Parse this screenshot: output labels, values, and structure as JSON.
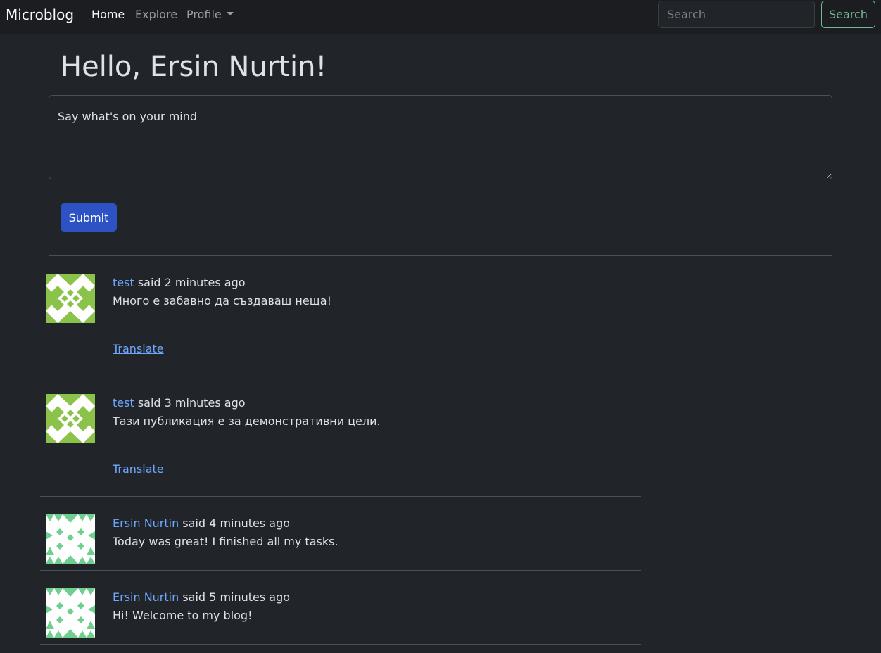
{
  "navbar": {
    "brand": "Microblog",
    "links": [
      {
        "label": "Home"
      },
      {
        "label": "Explore"
      },
      {
        "label": "Profile"
      }
    ],
    "search_placeholder": "Search",
    "search_button": "Search"
  },
  "main": {
    "title": "Hello, Ersin Nurtin!",
    "textarea_placeholder": "Say what's on your mind",
    "submit_label": "Submit"
  },
  "posts": [
    {
      "author": "test",
      "said": "said 2 minutes ago",
      "body": "Много е забавно да създаваш неща!",
      "translate": "Translate"
    },
    {
      "author": "test",
      "said": "said 3 minutes ago",
      "body": "Тази публикация е за демонстративни цели.",
      "translate": "Translate"
    },
    {
      "author": "Ersin Nurtin",
      "said": "said 4 minutes ago",
      "body": "Today was great! I finished all my tasks."
    },
    {
      "author": "Ersin Nurtin",
      "said": "said 5 minutes ago",
      "body": "Hi! Welcome to my blog!"
    }
  ],
  "colors": {
    "background": "#212529",
    "navbar": "#1b1d20",
    "link": "#6ea8fe",
    "submit": "#2d52c4",
    "search_outline": "#75b798",
    "avatar_test": "#8bc34a",
    "avatar_ersin": "#6fcf8f"
  },
  "icons": {
    "avatar_test": "identicon-avatar",
    "avatar_ersin": "identicon-avatar"
  }
}
